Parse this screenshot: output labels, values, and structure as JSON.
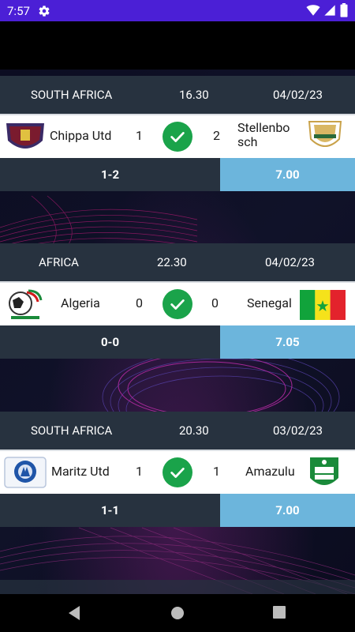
{
  "status": {
    "time": "7:57"
  },
  "matches": [
    {
      "league": "SOUTH AFRICA",
      "time": "16.30",
      "date": "04/02/23",
      "home": "Chippa Utd",
      "home_score": "1",
      "away": "Stellenbosch",
      "away_score": "2",
      "result": "1-2",
      "odds": "7.00"
    },
    {
      "league": "AFRICA",
      "time": "22.30",
      "date": "04/02/23",
      "home": "Algeria",
      "home_score": "0",
      "away": "Senegal",
      "away_score": "0",
      "result": "0-0",
      "odds": "7.05"
    },
    {
      "league": "SOUTH AFRICA",
      "time": "20.30",
      "date": "03/02/23",
      "home": "Maritz Utd",
      "home_score": "1",
      "away": "Amazulu",
      "away_score": "1",
      "result": "1-1",
      "odds": "7.00"
    }
  ],
  "colors": {
    "status_bar": "#4b1fd6",
    "header": "#27323f",
    "odds": "#6cb5dc",
    "check": "#1aa34a"
  }
}
